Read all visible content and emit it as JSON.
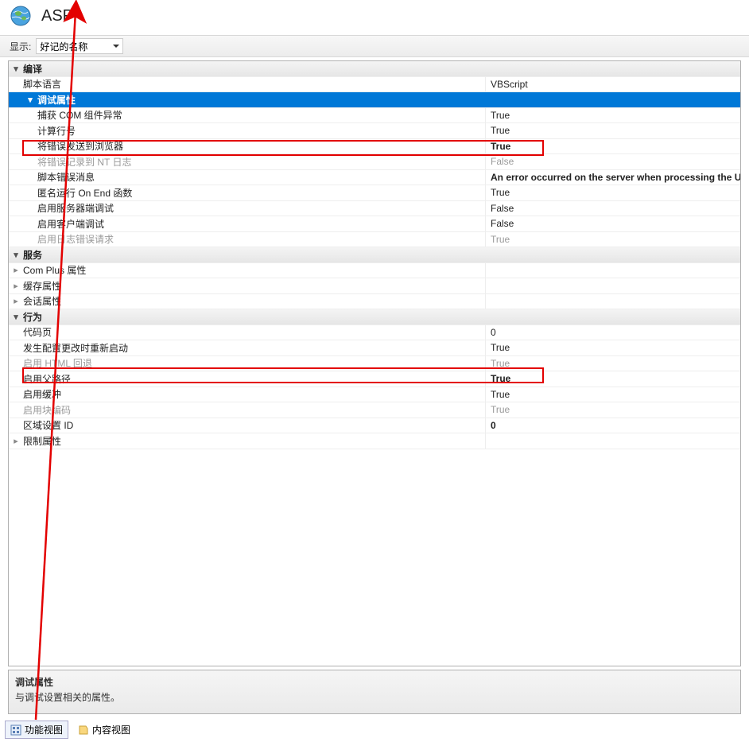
{
  "header": {
    "title": "ASP"
  },
  "toolbar": {
    "display_label": "显示:",
    "display_value": "好记的名称"
  },
  "grid": {
    "groups": [
      {
        "label": "编译",
        "expanded": true,
        "rows": [
          {
            "label": "脚本语言",
            "value": "VBScript",
            "indent": 1
          },
          {
            "is_cat": true,
            "label": "调试属性",
            "selected": true,
            "indent": 1,
            "expanded": true
          },
          {
            "label": "捕获 COM 组件异常",
            "value": "True",
            "indent": 2
          },
          {
            "label": "计算行号",
            "value": "True",
            "indent": 2
          },
          {
            "label": "将错误发送到浏览器",
            "value": "True",
            "indent": 2,
            "bold": true
          },
          {
            "label": "将错误记录到 NT 日志",
            "value": "False",
            "indent": 2,
            "disabled": true
          },
          {
            "label": "脚本错误消息",
            "value": "An error occurred on the server when processing the U",
            "indent": 2,
            "bold": true
          },
          {
            "label": "匿名运行 On End 函数",
            "value": "True",
            "indent": 2
          },
          {
            "label": "启用服务器端调试",
            "value": "False",
            "indent": 2
          },
          {
            "label": "启用客户端调试",
            "value": "False",
            "indent": 2
          },
          {
            "label": "启用日志错误请求",
            "value": "True",
            "indent": 2,
            "disabled": true
          }
        ]
      },
      {
        "label": "服务",
        "expanded": true,
        "rows": [
          {
            "label": "Com Plus 属性",
            "indent": 1,
            "chevron": true
          },
          {
            "label": "缓存属性",
            "indent": 1,
            "chevron": true
          },
          {
            "label": "会话属性",
            "indent": 1,
            "chevron": true
          }
        ]
      },
      {
        "label": "行为",
        "expanded": true,
        "rows": [
          {
            "label": "代码页",
            "value": "0",
            "indent": 1
          },
          {
            "label": "发生配置更改时重新启动",
            "value": "True",
            "indent": 1
          },
          {
            "label": "启用 HTML 回退",
            "value": "True",
            "indent": 1,
            "disabled": true
          },
          {
            "label": "启用父路径",
            "value": "True",
            "indent": 1,
            "bold": true
          },
          {
            "label": "启用缓冲",
            "value": "True",
            "indent": 1
          },
          {
            "label": "启用块编码",
            "value": "True",
            "indent": 1,
            "disabled": true
          },
          {
            "label": "区域设置 ID",
            "value": "0",
            "indent": 1,
            "bold": true
          },
          {
            "label": "限制属性",
            "indent": 1,
            "chevron": true
          }
        ]
      }
    ]
  },
  "description": {
    "title": "调试属性",
    "text": "与调试设置相关的属性。"
  },
  "tabs": {
    "feature_view": "功能视图",
    "content_view": "内容视图"
  }
}
